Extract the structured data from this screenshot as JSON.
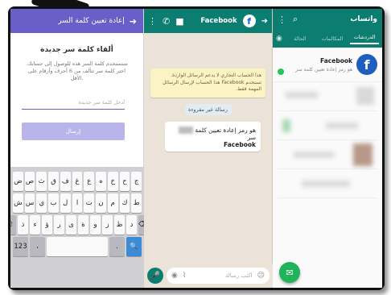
{
  "panel1": {
    "header_title": "إعادة تعيين كلمة السر",
    "back_icon": "arrow-right-icon",
    "heading": "ألقاء كلمة سر جديدة",
    "description": "ستستخدم كلمة السر هذه للوصول إلى حسابك. اختر كلمة سر تتألف من 6 أحرف وأرقام على الأقل.",
    "input_placeholder": "أدخل كلمة سر جديدة",
    "send_label": "إرسال",
    "keyboard": {
      "row1": [
        "ض",
        "ص",
        "ث",
        "ق",
        "ف",
        "غ",
        "ع",
        "ه",
        "خ",
        "ح",
        "ج"
      ],
      "row2": [
        "ش",
        "س",
        "ي",
        "ب",
        "ل",
        "ا",
        "ت",
        "ن",
        "م",
        "ك",
        "ط"
      ],
      "row3": [
        "ذ",
        "ء",
        "ؤ",
        "ر",
        "ى",
        "ة",
        "و",
        "ز",
        "ظ",
        "د"
      ],
      "row4": [
        "123",
        "،",
        "English",
        "عربي",
        ".",
        "⏎"
      ],
      "shift": "⇧",
      "delete": "⌫"
    }
  },
  "panel2": {
    "contact_name": "Facebook",
    "avatar_letter": "f",
    "notice": "هذا الحساب التجاري لا يدعم الرسائل الواردة. تستخدم Facebook هذا الحساب لإرسال الرسائل المهمة فقط.",
    "date_chip": "رسالة غير مقروءة",
    "message_code": "هو رمز إعادة تعيين كلمة سر",
    "message_from": "Facebook",
    "input_placeholder": "اكتب رسالة",
    "icons": {
      "back": "arrow-right-icon",
      "video": "video-camera-icon",
      "call": "phone-icon",
      "menu": "more-vertical-icon",
      "mic": "microphone-icon",
      "camera": "camera-icon",
      "attach": "paperclip-icon",
      "emoji": "emoji-icon"
    }
  },
  "panel3": {
    "app_title": "واتساب",
    "tabs": [
      "الحالة",
      "المكالمات",
      "الدردشات"
    ],
    "active_tab": 2,
    "chat": {
      "name": "Facebook",
      "preview": "هو رمز إعادة تعيين كلمة سر",
      "avatar_letter": "f"
    },
    "fab_icon": "new-chat-icon",
    "icons": {
      "search": "search-icon",
      "menu": "more-vertical-icon",
      "camera": "camera-icon"
    }
  },
  "colors": {
    "panel1_header": "#6a5fc9",
    "whatsapp_green": "#0b7d71",
    "chat_wallpaper": "#ece3d8",
    "facebook_blue": "#1d5fc0",
    "unread_badge": "#27c45a"
  }
}
